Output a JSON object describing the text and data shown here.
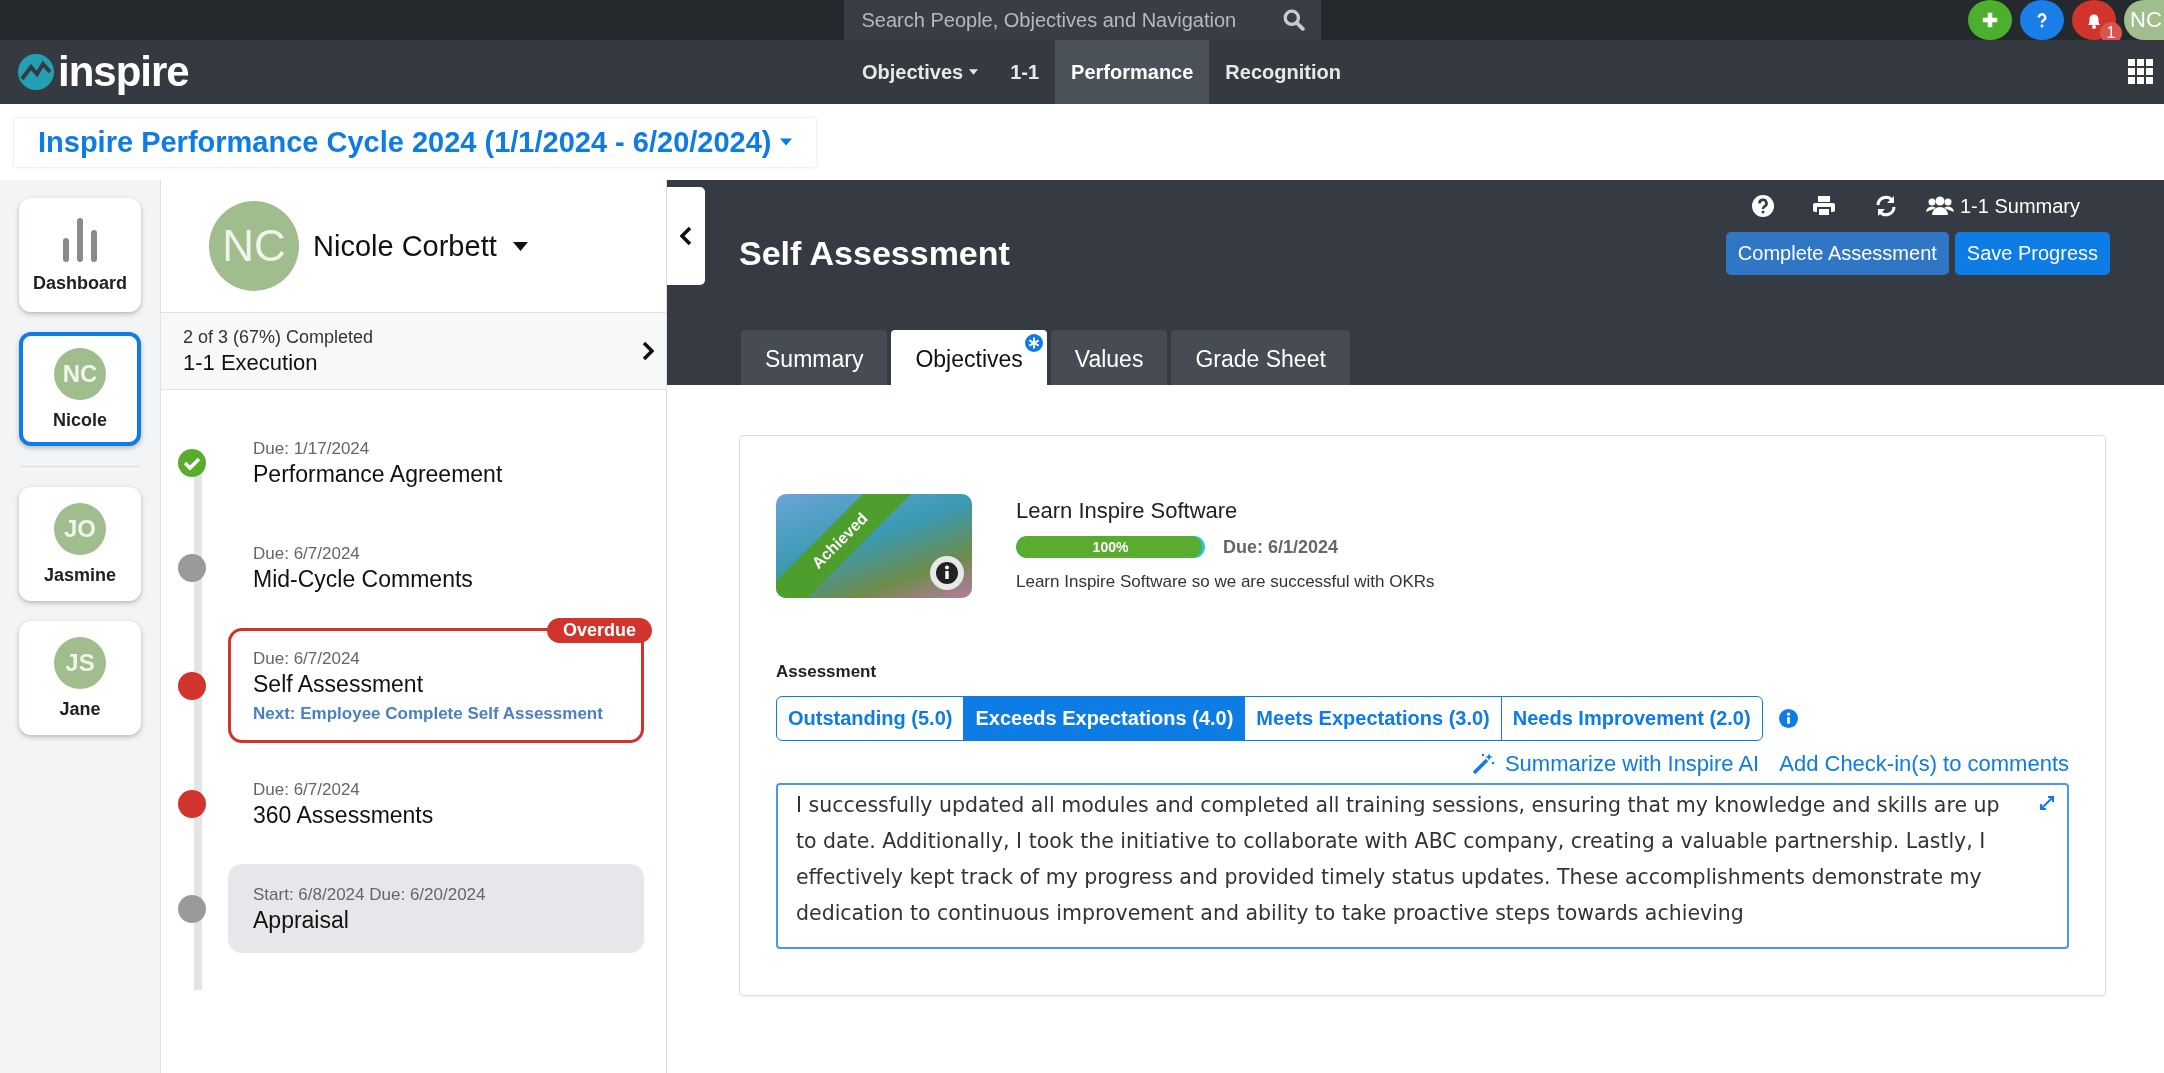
{
  "topbar": {
    "search_placeholder": "Search People, Objectives and Navigation",
    "notifications": "1",
    "avatar": "NC"
  },
  "navbar": {
    "logo": "inspire",
    "items": [
      {
        "label": "Objectives",
        "dropdown": true,
        "selected": false
      },
      {
        "label": "1-1",
        "dropdown": false,
        "selected": false
      },
      {
        "label": "Performance",
        "dropdown": false,
        "selected": true
      },
      {
        "label": "Recognition",
        "dropdown": false,
        "selected": false
      }
    ]
  },
  "cycle": {
    "title": "Inspire Performance Cycle 2024 (1/1/2024 - 6/20/2024)"
  },
  "rail": {
    "dashboard": "Dashboard",
    "people": [
      {
        "initials": "NC",
        "name": "Nicole",
        "selected": true
      },
      {
        "initials": "JO",
        "name": "Jasmine",
        "selected": false
      },
      {
        "initials": "JS",
        "name": "Jane",
        "selected": false
      }
    ]
  },
  "person": {
    "initials": "NC",
    "name": "Nicole Corbett"
  },
  "progress": {
    "text": "2 of 3 (67%) Completed",
    "title": "1-1 Execution"
  },
  "steps": [
    {
      "date": "Due: 1/17/2024",
      "title": "Performance Agreement",
      "kind": "done",
      "flagged": false,
      "current": false
    },
    {
      "date": "Due: 6/7/2024",
      "title": "Mid-Cycle Comments",
      "kind": "pending",
      "flagged": false,
      "current": false
    },
    {
      "date": "Due: 6/7/2024",
      "title": "Self Assessment",
      "kind": "overdue",
      "flagged": true,
      "current": false,
      "badge": "Overdue",
      "next": "Next: Employee Complete Self Assessment"
    },
    {
      "date": "Due: 6/7/2024",
      "title": "360 Assessments",
      "kind": "overdue",
      "flagged": false,
      "current": false
    },
    {
      "date": "Start: 6/8/2024 Due: 6/20/2024",
      "title": "Appraisal",
      "kind": "pending",
      "flagged": false,
      "current": true
    }
  ],
  "header": {
    "title": "Self Assessment",
    "summary_link": "1-1 Summary",
    "buttons": [
      {
        "label": "Complete Assessment",
        "kind": "secondary"
      },
      {
        "label": "Save Progress",
        "kind": "primary"
      }
    ],
    "tabs": [
      {
        "label": "Summary",
        "selected": false,
        "marked": false
      },
      {
        "label": "Objectives",
        "selected": true,
        "marked": true
      },
      {
        "label": "Values",
        "selected": false,
        "marked": false
      },
      {
        "label": "Grade Sheet",
        "selected": false,
        "marked": false
      }
    ]
  },
  "objective": {
    "ribbon": "Achieved",
    "title": "Learn Inspire Software",
    "level": 1,
    "progress_label": "100%",
    "due": "Due: 6/1/2024",
    "description": "Learn Inspire Software so we are successful with OKRs"
  },
  "assessment": {
    "label": "Assessment",
    "options": [
      {
        "label": "Outstanding (5.0)",
        "selected": false
      },
      {
        "label": "Exceeds Expectations (4.0)",
        "selected": true
      },
      {
        "label": "Meets Expectations (3.0)",
        "selected": false
      },
      {
        "label": "Needs Improvement (2.0)",
        "selected": false
      }
    ],
    "ai_link": "Summarize with Inspire AI",
    "checkin_link": "Add Check-in(s) to comments",
    "comment": "I successfully updated all modules and completed all training sessions, ensuring that my knowledge and skills are up to date. Additionally, I took the initiative to collaborate with ABC company, creating a valuable partnership. Lastly, I effectively kept track of my progress and provided timely status updates. These accomplishments demonstrate my dedication to continuous improvement and ability to take proactive steps towards achieving"
  }
}
